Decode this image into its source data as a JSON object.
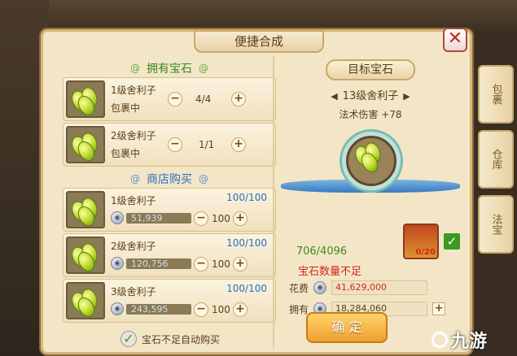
{
  "title": "便捷合成",
  "close_icon": "close-icon",
  "side_tabs": [
    "包裹",
    "仓库",
    "法宝"
  ],
  "owned_section": "拥有宝石",
  "owned": [
    {
      "name": "1级舍利子",
      "location": "包裹中",
      "qty": "4/4"
    },
    {
      "name": "2级舍利子",
      "location": "包裹中",
      "qty": "1/1"
    }
  ],
  "shop_section": "商店购买",
  "shop": [
    {
      "name": "1级舍利子",
      "stock": "100/100",
      "price": "51,939",
      "qty": "100"
    },
    {
      "name": "2级舍利子",
      "stock": "100/100",
      "price": "120,756",
      "qty": "100"
    },
    {
      "name": "3级舍利子",
      "stock": "100/100",
      "price": "243,595",
      "qty": "100"
    }
  ],
  "auto_buy": "宝石不足自动购买",
  "target_title": "目标宝石",
  "target_level": "13级舍利子",
  "target_effect": "法术伤害 +78",
  "progress": "706/4096",
  "warning": "宝石数量不足",
  "item_count": "0/20",
  "cost_label": "花费",
  "cost_value": "41,629,000",
  "own_label": "拥有",
  "own_value": "18,284,060",
  "confirm_label": "确  定",
  "watermark": "九游",
  "colors": {
    "green": "#3a8a22",
    "blue": "#2a6fc0",
    "red": "#d0281c"
  }
}
